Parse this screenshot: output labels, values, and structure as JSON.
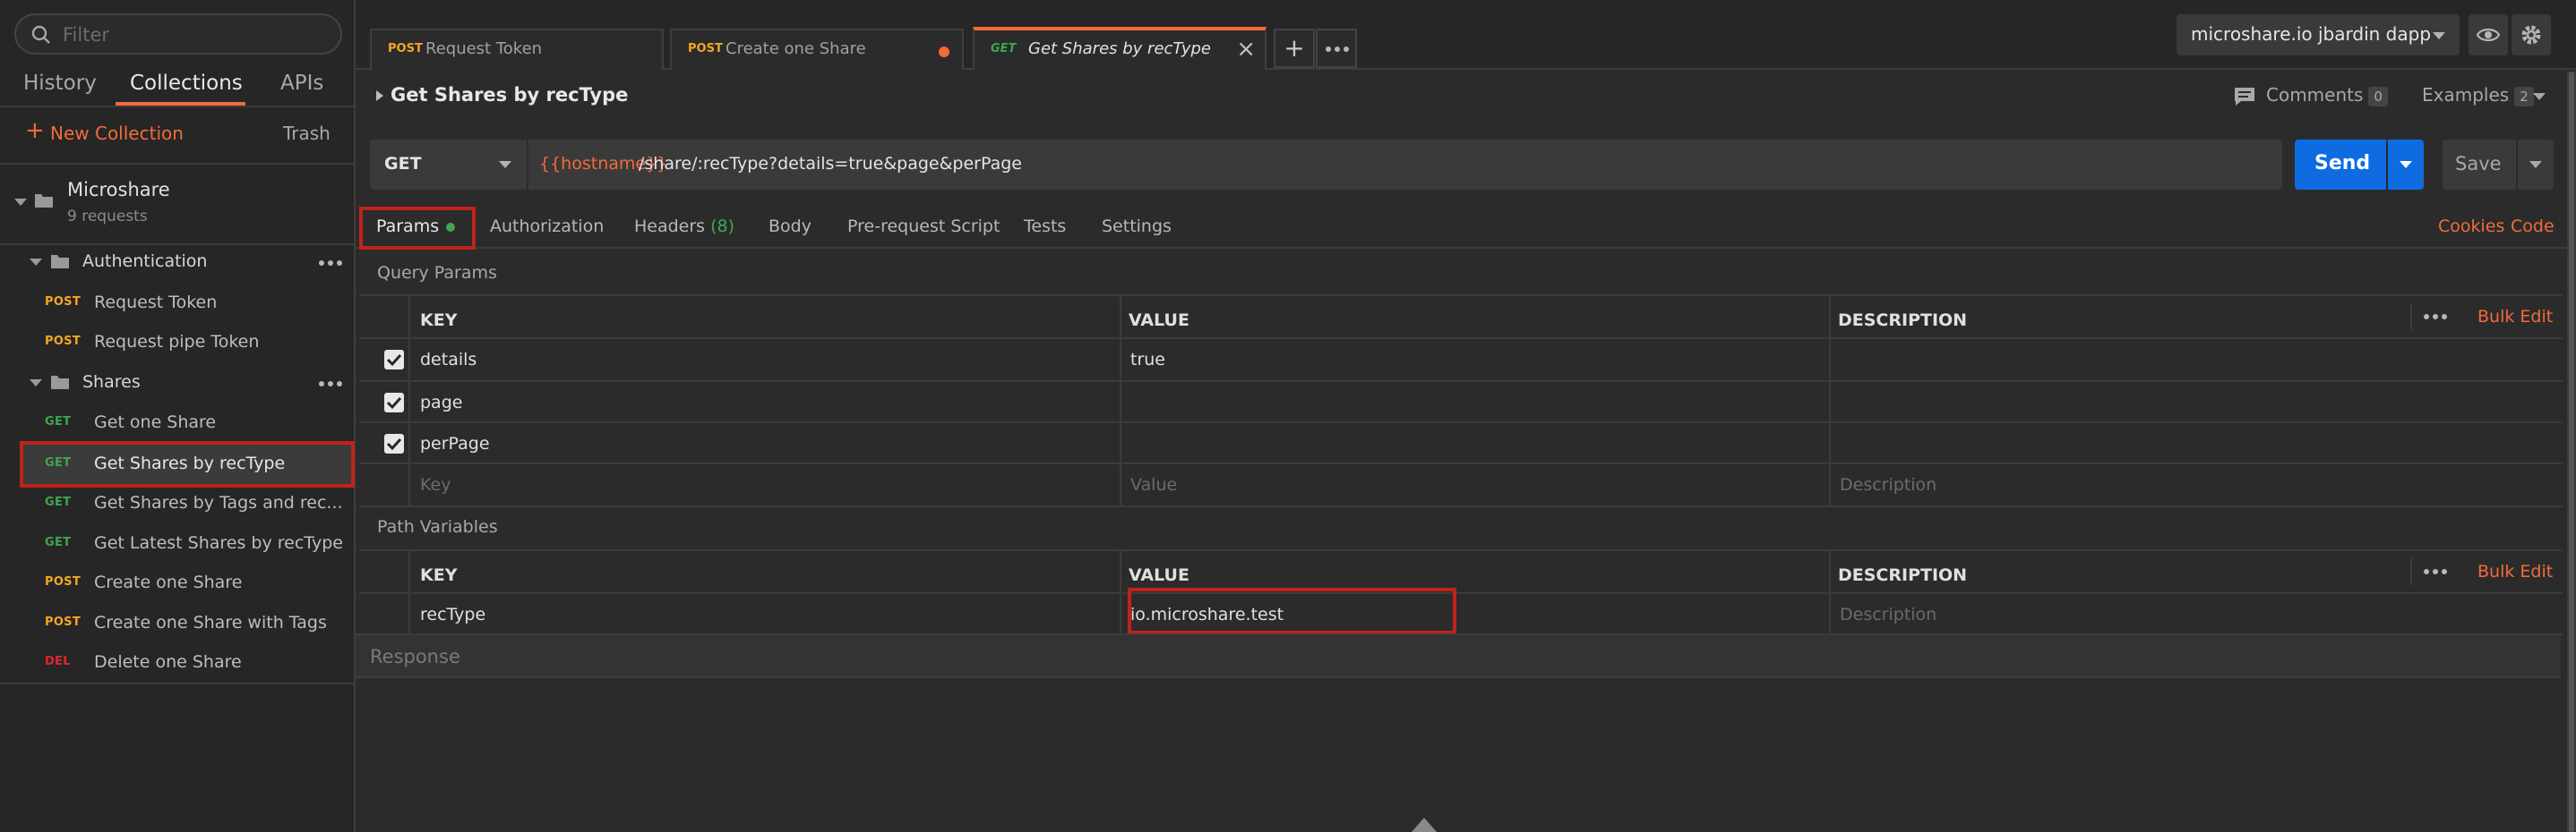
{
  "sidebar": {
    "filter_placeholder": "Filter",
    "tabs": [
      "History",
      "Collections",
      "APIs"
    ],
    "new_collection": "New Collection",
    "trash": "Trash",
    "collection": {
      "name": "Microshare",
      "count": "9 requests"
    },
    "folders": [
      "Authentication",
      "Shares"
    ],
    "auth_requests": [
      {
        "method": "POST",
        "name": "Request Token"
      },
      {
        "method": "POST",
        "name": "Request pipe Token"
      }
    ],
    "share_requests": [
      {
        "method": "GET",
        "name": "Get one Share"
      },
      {
        "method": "GET",
        "name": "Get Shares by recType"
      },
      {
        "method": "GET",
        "name": "Get Shares by Tags and rec..."
      },
      {
        "method": "GET",
        "name": "Get Latest Shares by recType"
      },
      {
        "method": "POST",
        "name": "Create one Share"
      },
      {
        "method": "POST",
        "name": "Create one Share with Tags"
      },
      {
        "method": "DEL",
        "name": "Delete one Share"
      }
    ]
  },
  "tabs": [
    {
      "method": "POST",
      "name": "Request Token"
    },
    {
      "method": "POST",
      "name": "Create one Share"
    },
    {
      "method": "GET",
      "name": "Get Shares by recType"
    }
  ],
  "environment": "microshare.io jbardin dapp",
  "request": {
    "title": "Get Shares by recType",
    "comments_label": "Comments",
    "comments_count": "0",
    "examples_label": "Examples",
    "examples_count": "2",
    "method": "GET",
    "url_var": "{{hostname}}",
    "url_path": "/share/:recType?details=true&page&perPage",
    "send": "Send",
    "save": "Save"
  },
  "req_tabs": {
    "params": "Params",
    "authorization": "Authorization",
    "headers": "Headers",
    "headers_count": "(8)",
    "body": "Body",
    "prerequest": "Pre-request Script",
    "tests": "Tests",
    "settings": "Settings",
    "cookies": "Cookies",
    "code": "Code"
  },
  "query_params": {
    "title": "Query Params",
    "headers": [
      "KEY",
      "VALUE",
      "DESCRIPTION"
    ],
    "bulk_edit": "Bulk Edit",
    "rows": [
      {
        "key": "details",
        "value": "true",
        "checked": true
      },
      {
        "key": "page",
        "value": "",
        "checked": true
      },
      {
        "key": "perPage",
        "value": "",
        "checked": true
      }
    ],
    "placeholders": {
      "key": "Key",
      "value": "Value",
      "description": "Description"
    }
  },
  "path_variables": {
    "title": "Path Variables",
    "headers": [
      "KEY",
      "VALUE",
      "DESCRIPTION"
    ],
    "bulk_edit": "Bulk Edit",
    "rows": [
      {
        "key": "recType",
        "value": "io.microshare.test"
      }
    ],
    "description_placeholder": "Description"
  },
  "response_label": "Response",
  "colors": {
    "accent": "#f26b3a",
    "send": "#0f6ce0",
    "get": "#3ea64f",
    "post": "#f5a623",
    "del": "#e0262b",
    "highlight": "#c0231c"
  }
}
